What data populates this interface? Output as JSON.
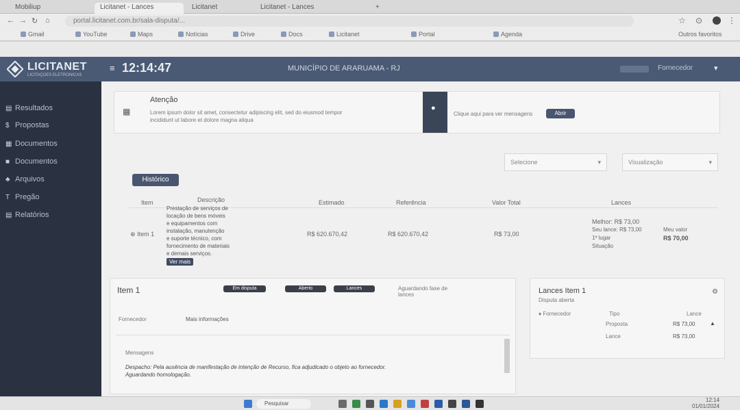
{
  "browser": {
    "tabs": [
      "Mobiliup",
      "Licitanet - Lances",
      "Licitanet",
      "Licitanet - Lances",
      "+"
    ],
    "url": "portal.licitanet.com.br/sala-disputa/...",
    "bookmarks": [
      "Gmail",
      "YouTube",
      "Maps",
      "Notícias",
      "Drive",
      "Docs",
      "Licitanet",
      "Portal",
      "Agenda",
      "Outros favoritos"
    ]
  },
  "header": {
    "logo_text": "LICITANET",
    "logo_sub": "LICITAÇÕES ELETRÔNICAS",
    "clock": "12:14:47",
    "title": "MUNICÍPIO DE ARARUAMA - RJ",
    "user_label": "Fornecedor"
  },
  "sidebar": {
    "items": [
      {
        "label": "Resultados",
        "icon": "📄"
      },
      {
        "label": "Propostas",
        "icon": "$"
      },
      {
        "label": "Documentos",
        "icon": "▦"
      },
      {
        "label": "Documentos",
        "icon": "■"
      },
      {
        "label": "Arquivos",
        "icon": "♣"
      },
      {
        "label": "Pregão",
        "icon": "T"
      },
      {
        "label": "Relatórios",
        "icon": "▤"
      }
    ]
  },
  "alert": {
    "title": "Atenção",
    "line1": "Lorem ipsum dolor sit amet, consectetur adipiscing elit, sed do eiusmod tempor",
    "line2": "incididunt ut labore et dolore magna aliqua",
    "side_text": "Clique aqui para ver mensagens",
    "side_button": "Abrir"
  },
  "filters": {
    "sort": "Selecione",
    "view": "Visualização"
  },
  "table_button": "Histórico",
  "table": {
    "headers": [
      "Item",
      "Descrição",
      "Estimado",
      "Referência",
      "Valor Total",
      "Lances"
    ],
    "row": {
      "item": "Item 1",
      "description": [
        "Prestação de serviços de",
        "locação de bens móveis",
        "e equipamentos com",
        "instalação, manutenção",
        "e suporte técnico, com",
        "fornecimento de materiais",
        "e demais serviços."
      ],
      "description_badge": "Ver mais",
      "estimated": "R$ 620.670,42",
      "reference": "R$ 620.670,42",
      "total": "R$ 73,00",
      "best_bid": "Melhor: R$ 73,00",
      "best_bid_sub": "Seu lance: R$ 73,00",
      "position": "1º lugar",
      "status_label": "Situação",
      "my_value_label": "Meu valor",
      "my_value": "R$ 70,00"
    }
  },
  "item_panel": {
    "title": "Item 1",
    "tags": [
      "Em disputa",
      "Aberto",
      "Lances"
    ],
    "tags_note": "Aguardando fase de lances",
    "sub_label": "Fornecedor",
    "sub_value": "Mais informações",
    "chat_label": "Mensagens",
    "message": "Despacho: Pela ausência de manifestação de intenção de Recurso, fica adjudicado o objeto ao fornecedor.",
    "message_sub": "Aguardando homologação."
  },
  "bids_panel": {
    "title": "Lances Item 1",
    "subtitle": "Disputa aberta",
    "col1": "Fornecedor",
    "col2": "Tipo",
    "col3": "Lance",
    "rows": [
      {
        "type": "Proposta",
        "value": "R$ 73,00"
      },
      {
        "type": "Lance",
        "value": "R$ 73,00"
      }
    ]
  },
  "taskbar": {
    "search": "Pesquisar",
    "clock": "12:14",
    "date": "01/01/2024"
  }
}
